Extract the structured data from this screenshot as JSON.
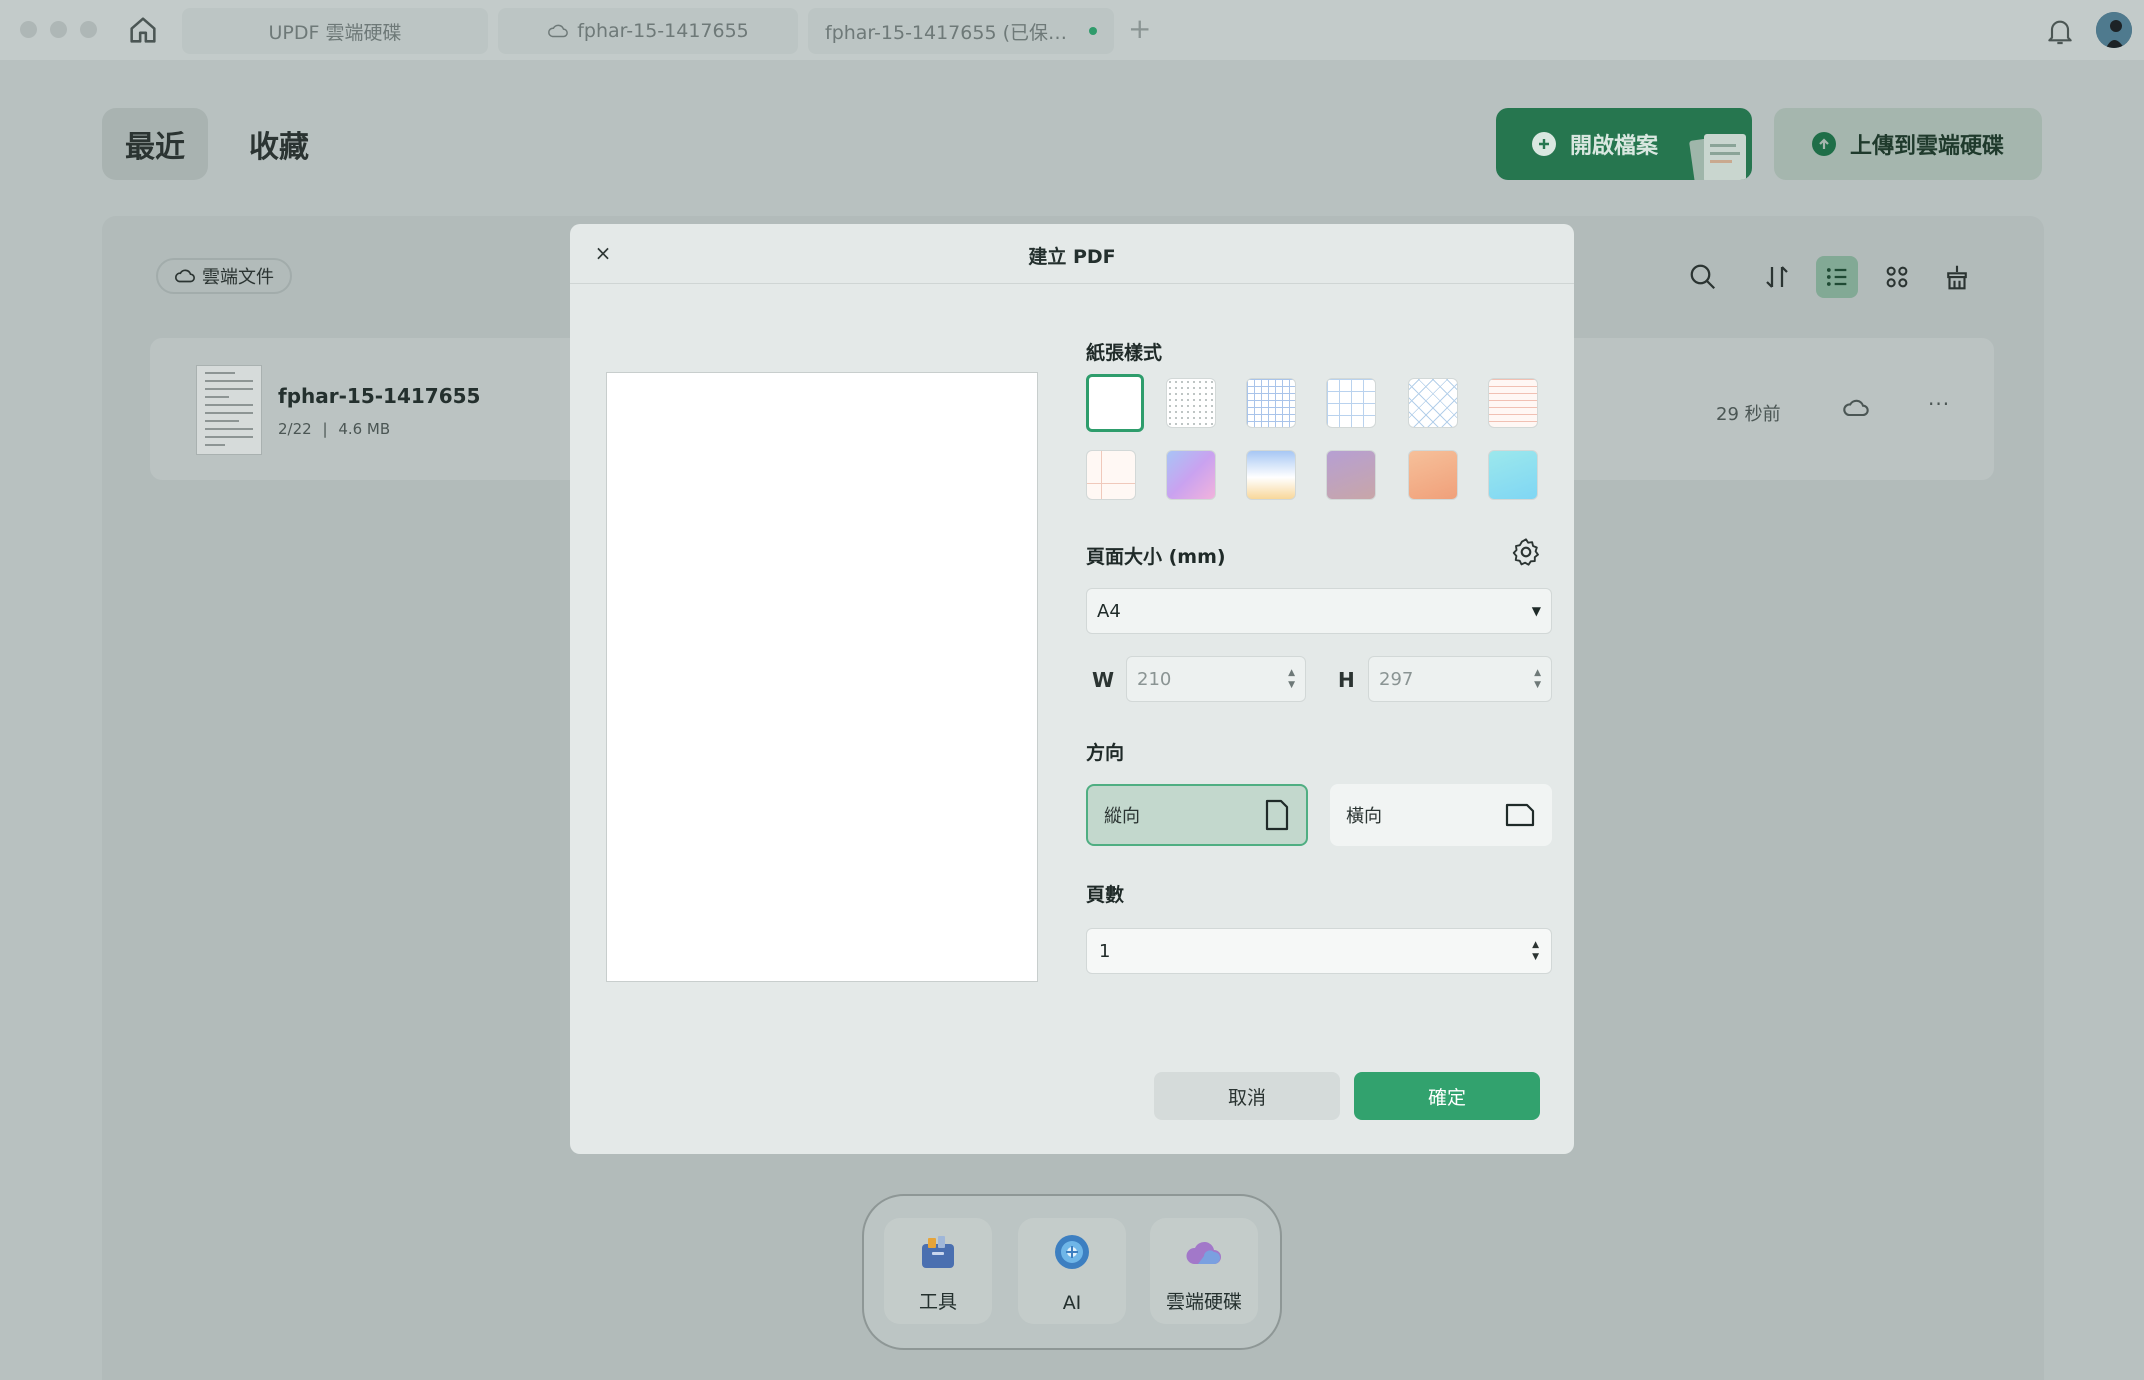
{
  "titlebar": {
    "tabs": [
      {
        "label": "UPDF 雲端硬碟"
      },
      {
        "label": "fphar-15-1417655"
      },
      {
        "label": "fphar-15-1417655 (已保…"
      }
    ],
    "new_tab": "+"
  },
  "main": {
    "tabs": [
      {
        "label": "最近"
      },
      {
        "label": "收藏"
      }
    ],
    "open_button": "開啟檔案",
    "upload_button": "上傳到雲端硬碟",
    "filter_chip": "雲端文件",
    "file": {
      "name": "fphar-15-1417655",
      "pages": "2/22",
      "separator": "|",
      "size": "4.6 MB",
      "time": "29 秒前",
      "more": "···"
    }
  },
  "dock": {
    "items": [
      {
        "label": "工具"
      },
      {
        "label": "AI"
      },
      {
        "label": "雲端硬碟"
      }
    ]
  },
  "modal": {
    "close": "×",
    "title": "建立 PDF",
    "paper_style_label": "紙張樣式",
    "paper_styles": [
      "blank",
      "dot-grid",
      "blue-grid",
      "large-grid",
      "diamond-grid",
      "ruled-orange",
      "cornell",
      "gradient-purple",
      "gradient-sunrise",
      "gradient-mauve",
      "gradient-peach",
      "gradient-aqua"
    ],
    "selected_style": "blank",
    "page_size_label": "頁面大小 (mm)",
    "page_size": "A4",
    "width_label": "W",
    "width": "210",
    "height_label": "H",
    "height": "297",
    "orientation_label": "方向",
    "portrait": "縱向",
    "landscape": "橫向",
    "selected_orientation": "portrait",
    "page_count_label": "頁數",
    "page_count": "1",
    "cancel": "取消",
    "confirm": "確定"
  },
  "colors": {
    "accent": "#32a26e",
    "overlay": "#b8c1c0",
    "modal_bg": "#e4e9e8"
  }
}
